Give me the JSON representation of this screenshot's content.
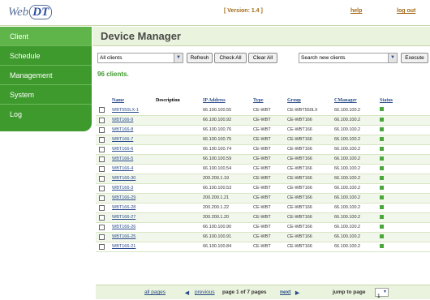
{
  "header": {
    "logo_prefix": "Web",
    "logo_suffix": "DT",
    "version": "[ Version: 1.4 ]",
    "help": "help",
    "logout": "log out"
  },
  "sidebar": {
    "items": [
      {
        "label": "Client"
      },
      {
        "label": "Schedule"
      },
      {
        "label": "Management"
      },
      {
        "label": "System"
      },
      {
        "label": "Log"
      }
    ],
    "active_color": "#5fb44a",
    "bg_color": "#3f9a2e"
  },
  "main": {
    "title": "Device Manager",
    "filter_select": "All clients",
    "refresh_label": "Refresh",
    "check_all_label": "Check All",
    "clear_all_label": "Clear All",
    "search_select": "Search new clients",
    "execute_label": "Execute",
    "client_count": "96 clients."
  },
  "table": {
    "headers": [
      "Name",
      "Description",
      "IP Address",
      "Type",
      "Group",
      "CManager",
      "Status"
    ],
    "rows": [
      {
        "name": "WBT550LX-1",
        "description": "",
        "ip": "66.100.100.55",
        "type": "CE-WBT",
        "group": "CE-WBT550LX",
        "cmanager": "66.100.100.2"
      },
      {
        "name": "WBT166-9",
        "description": "",
        "ip": "66.100.100.92",
        "type": "CE-WBT",
        "group": "CE-WBT166",
        "cmanager": "66.100.100.2"
      },
      {
        "name": "WBT166-8",
        "description": "",
        "ip": "66.100.100.76",
        "type": "CE-WBT",
        "group": "CE-WBT166",
        "cmanager": "66.100.100.2"
      },
      {
        "name": "WBT166-7",
        "description": "",
        "ip": "66.100.100.75",
        "type": "CE-WBT",
        "group": "CE-WBT166",
        "cmanager": "66.100.100.2"
      },
      {
        "name": "WBT166-6",
        "description": "",
        "ip": "66.100.100.74",
        "type": "CE-WBT",
        "group": "CE-WBT166",
        "cmanager": "66.100.100.2"
      },
      {
        "name": "WBT166-5",
        "description": "",
        "ip": "66.100.100.59",
        "type": "CE-WBT",
        "group": "CE-WBT166",
        "cmanager": "66.100.100.2"
      },
      {
        "name": "WBT166-4",
        "description": "",
        "ip": "66.100.100.54",
        "type": "CE-WBT",
        "group": "CE-WBT166",
        "cmanager": "66.100.100.2"
      },
      {
        "name": "WBT166-30",
        "description": "",
        "ip": "200.200.1.19",
        "type": "CE-WBT",
        "group": "CE-WBT166",
        "cmanager": "66.100.100.2"
      },
      {
        "name": "WBT166-3",
        "description": "",
        "ip": "66.100.100.53",
        "type": "CE-WBT",
        "group": "CE-WBT166",
        "cmanager": "66.100.100.2"
      },
      {
        "name": "WBT166-29",
        "description": "",
        "ip": "200.200.1.21",
        "type": "CE-WBT",
        "group": "CE-WBT166",
        "cmanager": "66.100.100.2"
      },
      {
        "name": "WBT166-28",
        "description": "",
        "ip": "200.200.1.22",
        "type": "CE-WBT",
        "group": "CE-WBT166",
        "cmanager": "66.100.100.2"
      },
      {
        "name": "WBT166-27",
        "description": "",
        "ip": "200.200.1.20",
        "type": "CE-WBT",
        "group": "CE-WBT166",
        "cmanager": "66.100.100.2"
      },
      {
        "name": "WBT166-26",
        "description": "",
        "ip": "66.100.100.90",
        "type": "CE-WBT",
        "group": "CE-WBT166",
        "cmanager": "66.100.100.2"
      },
      {
        "name": "WBT166-25",
        "description": "",
        "ip": "66.100.100.91",
        "type": "CE-WBT",
        "group": "CE-WBT166",
        "cmanager": "66.100.100.2"
      },
      {
        "name": "WBT166-21",
        "description": "",
        "ip": "66.100.100.84",
        "type": "CE-WBT",
        "group": "CE-WBT166",
        "cmanager": "66.100.100.2"
      }
    ],
    "status_color": "#4aa83a"
  },
  "pager": {
    "all_pages": "all pages",
    "previous": "previous",
    "page_info": "page 1 of 7 pages",
    "next": "next",
    "jump_label": "jump to page",
    "page_select": "1"
  }
}
